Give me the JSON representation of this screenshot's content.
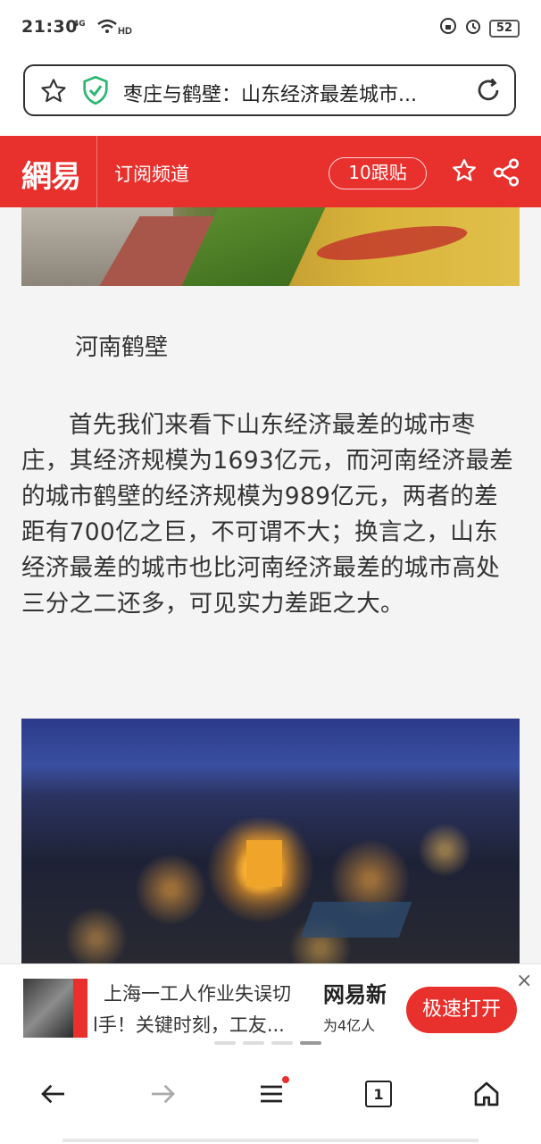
{
  "status_bar": {
    "time": "21:30",
    "network": "4G",
    "wifi_label": "HD",
    "battery": "52"
  },
  "address_bar": {
    "page_title": "枣庄与鹤壁：山东经济最差城市..."
  },
  "site_header": {
    "logo": "網易",
    "channel_link": "订阅频道",
    "comments": "10跟贴"
  },
  "article": {
    "subheading": "河南鹤壁",
    "paragraph": "首先我们来看下山东经济最差的城市枣庄，其经济规模为1693亿元，而河南经济最差的城市鹤壁的经济规模为989亿元，两者的差距有700亿之巨，不可谓不大；换言之，山东经济最差的城市也比河南经济最差的城市高处三分之二还多，可见实力差距之大。"
  },
  "ad": {
    "headline_1": "上海一工人作业失误切",
    "headline_2": "l手！关键时刻，工友...",
    "brand": "网易新",
    "brand_sub": "为4亿人",
    "open_button": "极速打开",
    "close": "×"
  },
  "bottom_nav": {
    "tab_count": "1"
  },
  "icons": {
    "address": [
      "star-icon",
      "shield-check-icon",
      "reload-icon"
    ],
    "header": [
      "star-icon",
      "share-icon"
    ],
    "nav": [
      "back-arrow-icon",
      "forward-arrow-icon",
      "menu-icon",
      "tabs-icon",
      "home-icon"
    ]
  },
  "colors": {
    "brand_red": "#e8302d",
    "shield_green": "#2bb673"
  }
}
